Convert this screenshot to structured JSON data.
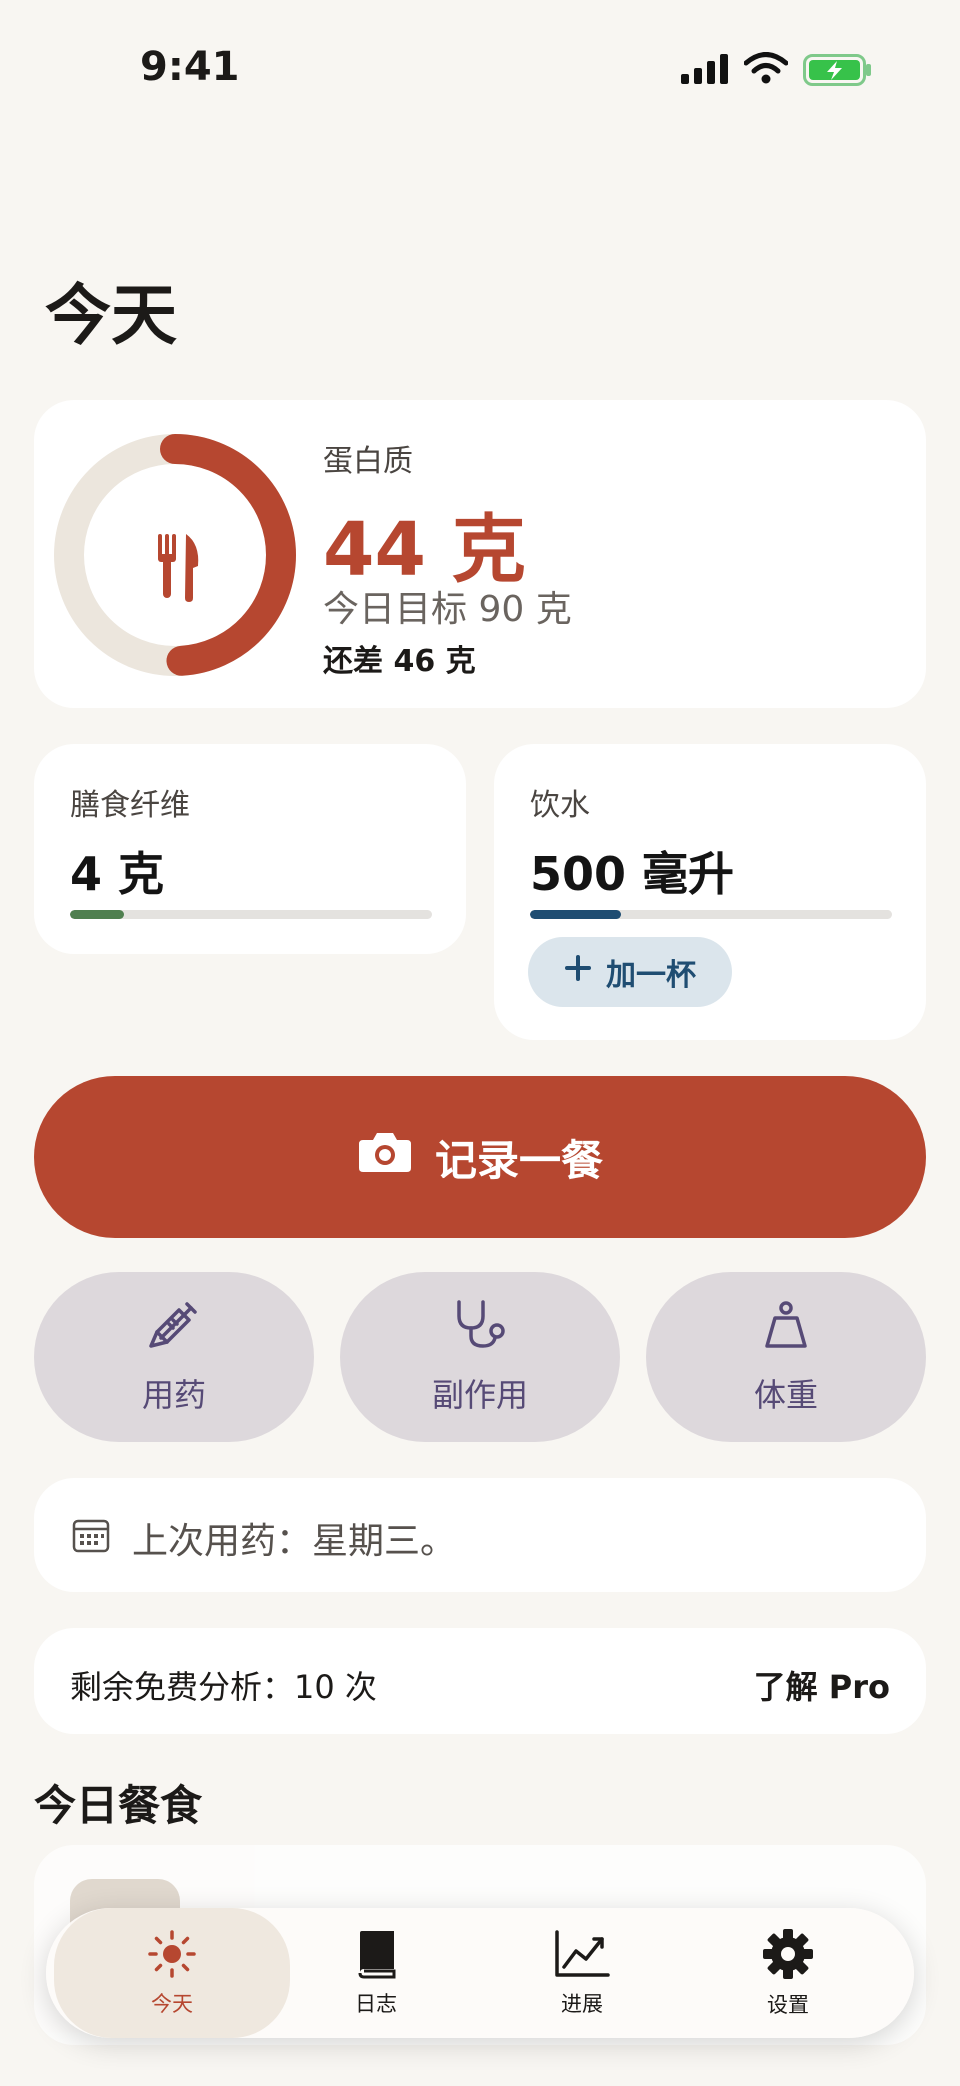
{
  "status_bar": {
    "time": "9:41"
  },
  "page_title": "今天",
  "protein": {
    "label": "蛋白质",
    "value": "44 克",
    "goal": "今日目标 90 克",
    "remaining": "还差 46 克",
    "progress": 0.49,
    "icon": "fork-knife-icon"
  },
  "fiber": {
    "label": "膳食纤维",
    "value": "4 克",
    "progress": 0.15,
    "color": "#4f7f4f"
  },
  "water": {
    "label": "饮水",
    "value": "500 毫升",
    "progress": 0.25,
    "color": "#1f4d72",
    "add_label": "加一杯"
  },
  "log_meal": {
    "label": "记录一餐",
    "icon": "camera-icon"
  },
  "actions": [
    {
      "label": "用药",
      "icon": "syringe-icon"
    },
    {
      "label": "副作用",
      "icon": "stethoscope-icon"
    },
    {
      "label": "体重",
      "icon": "scale-icon"
    }
  ],
  "last_dose": {
    "text": "上次用药：星期三。",
    "icon": "calendar-icon"
  },
  "free_analysis": {
    "text": "剩余免费分析：10 次",
    "link": "了解 Pro"
  },
  "meals_section": {
    "title": "今日餐食"
  },
  "tabs": [
    {
      "label": "今天",
      "icon": "sun-icon",
      "active": true
    },
    {
      "label": "日志",
      "icon": "book-icon",
      "active": false
    },
    {
      "label": "进展",
      "icon": "chart-line-icon",
      "active": false
    },
    {
      "label": "设置",
      "icon": "gear-icon",
      "active": false
    }
  ],
  "colors": {
    "accent": "#b64730",
    "background": "#f8f6f2",
    "pill": "#ddd8dc",
    "water": "#1f4d72",
    "fiber": "#4f7f4f"
  }
}
